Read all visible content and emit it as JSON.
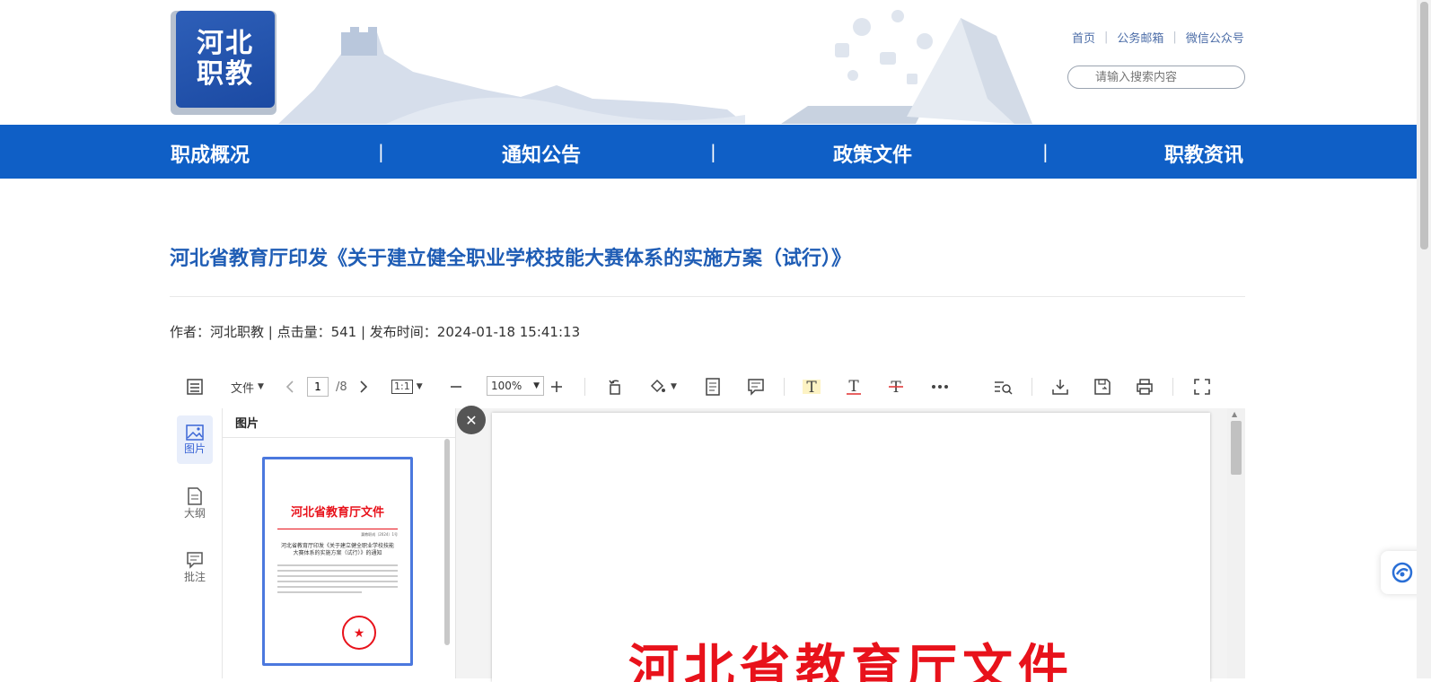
{
  "logo": {
    "line1": "河北",
    "line2": "职教"
  },
  "header_links": [
    "首页",
    "公务邮箱",
    "微信公众号"
  ],
  "search": {
    "placeholder": "请输入搜索内容"
  },
  "nav": [
    "职成概况",
    "通知公告",
    "政策文件",
    "职教资讯"
  ],
  "nav_separator": "|",
  "article": {
    "title": "河北省教育厅印发《关于建立健全职业学校技能大赛体系的实施方案（试行）》",
    "meta": "作者：河北职教 | 点击量：541 | 发布时间：2024-01-18 15:41:13"
  },
  "viewer": {
    "file_menu": "文件",
    "page_current": "1",
    "page_total": "/8",
    "fit_label": "1:1",
    "zoom": "100%",
    "side_tabs": [
      "图片",
      "大纲",
      "批注"
    ],
    "thumb_panel_title": "图片",
    "close_symbol": "✕",
    "thumb_heading": "河北省教育厅文件",
    "thumb_docno": "冀教职成〔2024〕1号",
    "thumb_subject": "河北省教育厅印发《关于建立健全职业学校技能大赛体系的实施方案（试行）》的通知",
    "page_heading": "河北省教育厅文件"
  },
  "colors": {
    "nav_bg": "#0f5fc6",
    "title": "#1f5db5",
    "doc_red": "#e8121b",
    "accent": "#3b66d6"
  }
}
